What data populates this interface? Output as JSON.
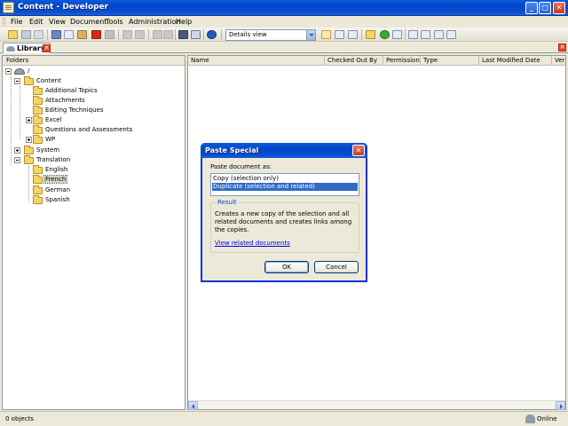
{
  "window": {
    "title": "Content - Developer",
    "minimize": "_",
    "maximize": "□",
    "close": "✕"
  },
  "menu": [
    "File",
    "Edit",
    "View",
    "Document",
    "Tools",
    "Administration",
    "Help"
  ],
  "toolbar": {
    "view_mode": "Details view"
  },
  "tabs": [
    {
      "label": "Library",
      "close": "✕"
    }
  ],
  "panel_close": "✕",
  "folders": {
    "header": "Folders",
    "items": [
      {
        "label": "/"
      },
      {
        "label": "Content"
      },
      {
        "label": "Additional Topics"
      },
      {
        "label": "Attachments"
      },
      {
        "label": "Editing Techniques"
      },
      {
        "label": "Excel"
      },
      {
        "label": "Questions and Assessments"
      },
      {
        "label": "WP"
      },
      {
        "label": "System"
      },
      {
        "label": "Translation"
      },
      {
        "label": "English"
      },
      {
        "label": "French"
      },
      {
        "label": "German"
      },
      {
        "label": "Spanish"
      }
    ]
  },
  "columns": [
    "Name",
    "Checked Out By",
    "Permission",
    "Type",
    "Last Modified Date",
    "Ver"
  ],
  "status": {
    "objects": "0 objects",
    "connection": "Online"
  },
  "dialog": {
    "title": "Paste Special",
    "close": "✕",
    "prompt": "Paste document as:",
    "options": [
      "Copy (selection only)",
      "Duplicate (selection and related)"
    ],
    "result_label": "Result",
    "result_text": "Creates a new copy of the selection and all related documents and creates links among the copies.",
    "link": "View related documents",
    "ok": "OK",
    "cancel": "Cancel"
  }
}
